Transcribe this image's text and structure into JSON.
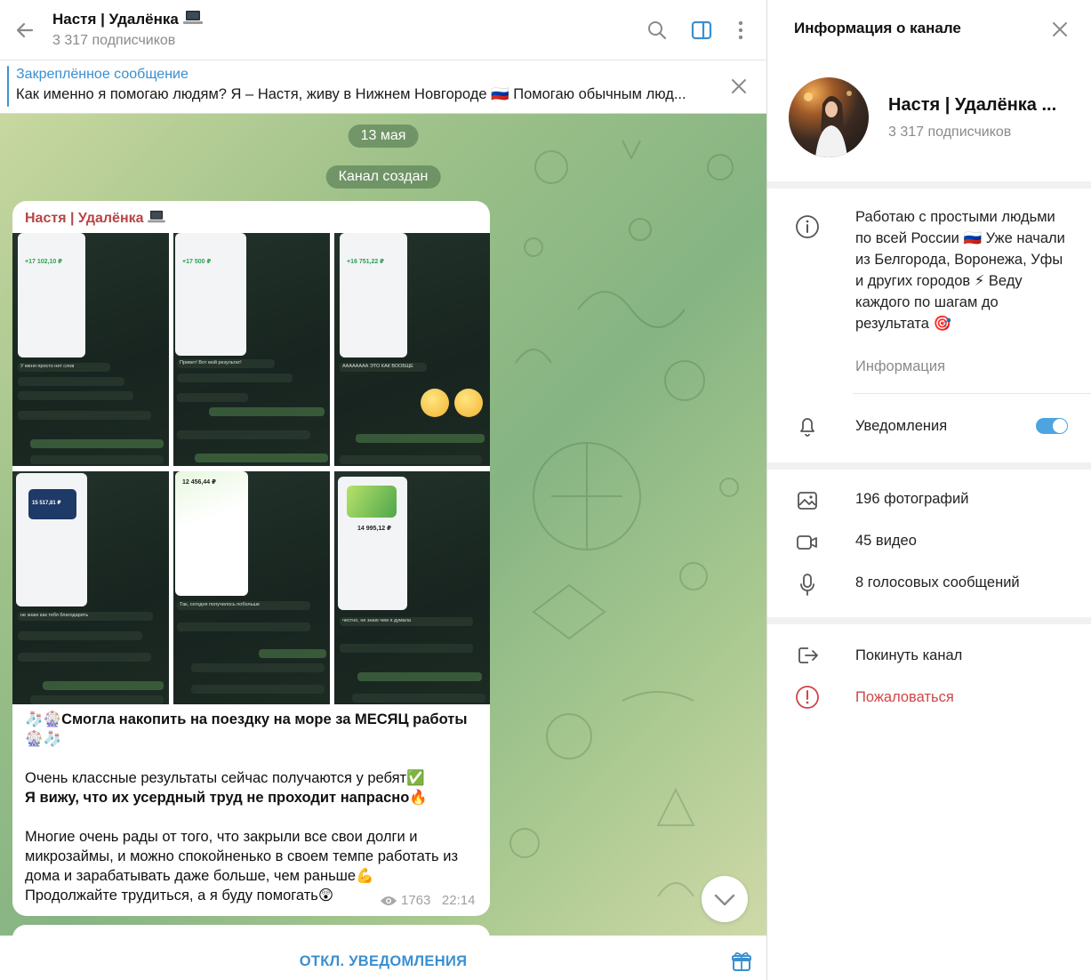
{
  "header": {
    "title": "Настя | Удалёнка",
    "subscribers": "3 317 подписчиков"
  },
  "pinned": {
    "label": "Закреплённое сообщение",
    "text": "Как именно я помогаю людям?  Я – Настя, живу в Нижнем Новгороде 🇷🇺 Помогаю обычным люд..."
  },
  "chat": {
    "date_pill": "13 мая",
    "created_pill": "Канал создан",
    "message": {
      "author": "Настя | Удалёнка",
      "line1": "🧦🎡Смогла накопить на поездку на море за МЕСЯЦ работы 🎡🧦",
      "line2": "Очень классные результаты сейчас получаются у ребят✅",
      "line3": "Я вижу, что их усердный труд не проходит напрасно🔥",
      "line4": "Многие очень рады от того, что закрыли все свои долги и микрозаймы, и можно спокойненько в своем темпе работать из дома и зарабатывать даже больше, чем раньше💪",
      "line5": "Продолжайте трудиться, а я буду помогать😲",
      "views": "1763",
      "time": "22:14"
    },
    "screenshots": [
      {
        "amount": "+17 102,10 ₽",
        "caption": "У меня просто нет слов"
      },
      {
        "amount": "+17 500 ₽",
        "caption": "Привет! Вот мой результат!"
      },
      {
        "amount": "+16 751,22 ₽",
        "caption": "АААААААА ЭТО КАК ВООБЩЕ"
      },
      {
        "amount": "15 517,81 ₽",
        "caption": "не знаю как тебя благодарить"
      },
      {
        "amount": "12 456,44 ₽",
        "caption": "Так, сегодня получилось побольше"
      },
      {
        "amount": "14 995,12 ₽",
        "caption": "честно, не знаю чем я думала"
      }
    ]
  },
  "footer": {
    "mute_label": "ОТКЛ. УВЕДОМЛЕНИЯ"
  },
  "side": {
    "title": "Информация о канале",
    "channel_name": "Настя | Удалёнка ...",
    "subscribers": "3 317 подписчиков",
    "about_text": "Работаю с простыми людьми по всей России 🇷🇺 Уже начали из Белгорода, Воронежа, Уфы и других городов ⚡ Веду каждого по шагам до результата 🎯",
    "about_label": "Информация",
    "notifications_label": "Уведомления",
    "notifications_on": true,
    "media": {
      "photos": "196 фотографий",
      "videos": "45 видео",
      "voice": "8 голосовых сообщений"
    },
    "leave_label": "Покинуть канал",
    "report_label": "Пожаловаться"
  },
  "colors": {
    "accent": "#3a8fd0",
    "author": "#b64545",
    "report": "#d04545",
    "toggle": "#4ea4e0"
  }
}
